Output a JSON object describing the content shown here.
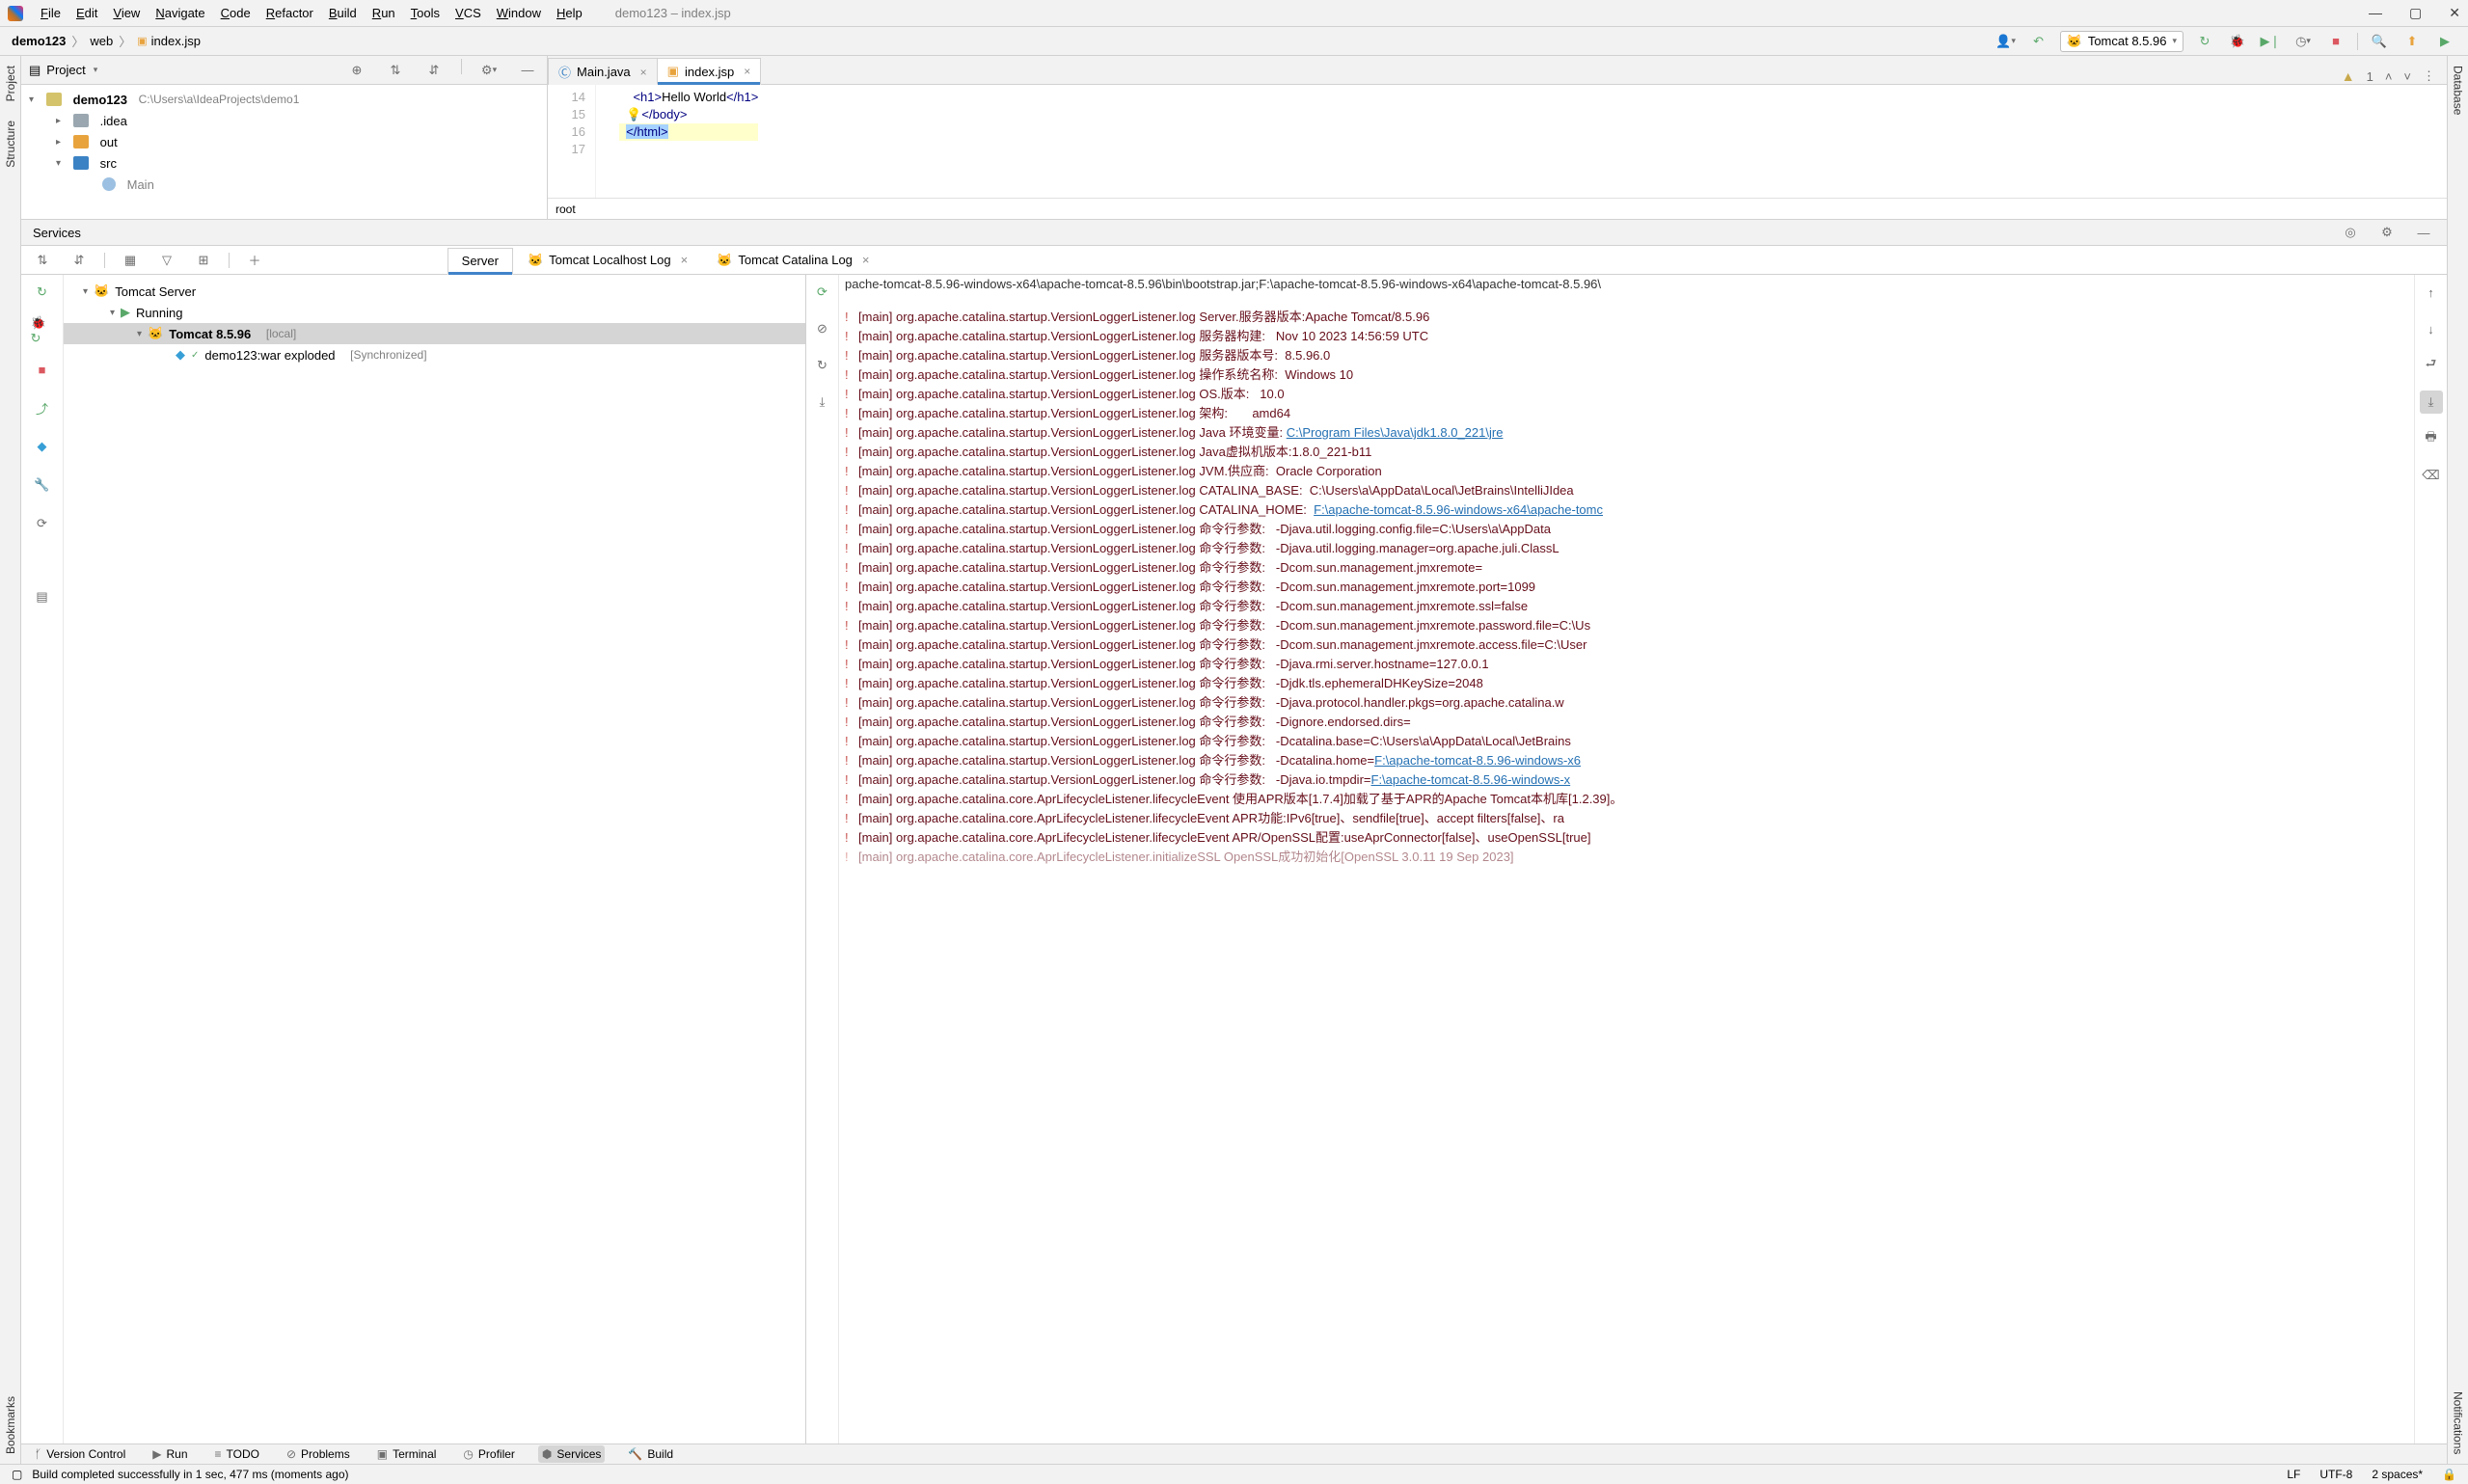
{
  "menu": {
    "items": [
      "File",
      "Edit",
      "View",
      "Navigate",
      "Code",
      "Refactor",
      "Build",
      "Run",
      "Tools",
      "VCS",
      "Window",
      "Help"
    ],
    "title": "demo123 – index.jsp"
  },
  "breadcrumbs": {
    "parts": [
      "demo123",
      "web",
      "index.jsp"
    ]
  },
  "run_config": {
    "label": "Tomcat 8.5.96"
  },
  "left_rail": {
    "top": [
      "Project",
      "Structure"
    ],
    "bottom": "Bookmarks"
  },
  "right_rail": {
    "top": "Database",
    "bottom": "Notifications"
  },
  "project": {
    "title": "Project",
    "root": {
      "name": "demo123",
      "path": "C:\\Users\\a\\IdeaProjects\\demo1"
    },
    "children": [
      {
        "name": ".idea",
        "kind": "dir-gray"
      },
      {
        "name": "out",
        "kind": "dir-orange"
      },
      {
        "name": "src",
        "kind": "dir-blue",
        "expanded": true
      },
      {
        "name": "Main",
        "kind": "file",
        "indent": 3,
        "truncated": true
      }
    ]
  },
  "editor": {
    "tabs": [
      {
        "name": "Main.java",
        "icon": "class"
      },
      {
        "name": "index.jsp",
        "icon": "jsp",
        "active": true
      }
    ],
    "lines": [
      {
        "n": 14,
        "html": "<h1>Hello World</h1>",
        "segments": [
          {
            "t": "<h1>",
            "c": "tag"
          },
          {
            "t": "Hello World",
            "c": "text"
          },
          {
            "t": "</h1>",
            "c": "tag"
          }
        ],
        "indent": "    "
      },
      {
        "n": 15,
        "segments": [
          {
            "t": "💡",
            "c": "bulb"
          },
          {
            "t": "</body>",
            "c": "tag"
          }
        ],
        "indent": "  "
      },
      {
        "n": 16,
        "segments": [
          {
            "t": "</html>",
            "c": "tag sel-tag"
          }
        ],
        "indent": "  ",
        "hi": true
      },
      {
        "n": 17,
        "segments": []
      }
    ],
    "crumb": "root",
    "warnings": "1"
  },
  "services": {
    "title": "Services",
    "tree": {
      "root": "Tomcat Server",
      "running": "Running",
      "item": {
        "name": "Tomcat 8.5.96",
        "suffix": "[local]"
      },
      "artifact": {
        "name": "demo123:war exploded",
        "suffix": "[Synchronized]"
      }
    },
    "tabs": [
      {
        "name": "Server",
        "active": true
      },
      {
        "name": "Tomcat Localhost Log",
        "icon": "tomcat"
      },
      {
        "name": "Tomcat Catalina Log",
        "icon": "tomcat"
      }
    ],
    "top_line": "pache-tomcat-8.5.96-windows-x64\\apache-tomcat-8.5.96\\bin\\bootstrap.jar;F:\\apache-tomcat-8.5.96-windows-x64\\apache-tomcat-8.5.96\\",
    "lines": [
      {
        "p": "[main] org.apache.catalina.startup.VersionLoggerListener.log Server.",
        "cn": "服务器版本:",
        "v": "Apache Tomcat/8.5.96"
      },
      {
        "p": "[main] org.apache.catalina.startup.VersionLoggerListener.log ",
        "cn": "服务器构建:",
        "v": "Nov 10 2023 14:56:59 UTC"
      },
      {
        "p": "[main] org.apache.catalina.startup.VersionLoggerListener.log ",
        "cn": "服务器版本号:",
        "v": "8.5.96.0"
      },
      {
        "p": "[main] org.apache.catalina.startup.VersionLoggerListener.log ",
        "cn": "操作系统名称:",
        "v": "Windows 10"
      },
      {
        "p": "[main] org.apache.catalina.startup.VersionLoggerListener.log OS.",
        "cn": "版本:",
        "v": "10.0"
      },
      {
        "p": "[main] org.apache.catalina.startup.VersionLoggerListener.log ",
        "cn": "架构:",
        "v": " amd64"
      },
      {
        "p": "[main] org.apache.catalina.startup.VersionLoggerListener.log Java ",
        "cn": "环境变量:",
        "v": " ",
        "link": "C:\\Program Files\\Java\\jdk1.8.0_221\\jre"
      },
      {
        "p": "[main] org.apache.catalina.startup.VersionLoggerListener.log Java",
        "cn": "虚拟机版本:",
        "v": "1.8.0_221-b11"
      },
      {
        "p": "[main] org.apache.catalina.startup.VersionLoggerListener.log JVM.",
        "cn": "供应商:",
        "v": " Oracle Corporation"
      },
      {
        "p": "[main] org.apache.catalina.startup.VersionLoggerListener.log CATALINA_BASE:",
        "cn": "",
        "v": "  C:\\Users\\a\\AppData\\Local\\JetBrains\\IntelliJIdea"
      },
      {
        "p": "[main] org.apache.catalina.startup.VersionLoggerListener.log CATALINA_HOME:",
        "cn": "",
        "v": "  ",
        "link": "F:\\apache-tomcat-8.5.96-windows-x64\\apache-tomc"
      },
      {
        "p": "[main] org.apache.catalina.startup.VersionLoggerListener.log ",
        "cn": "命令行参数:",
        "v": "-Djava.util.logging.config.file=C:\\Users\\a\\AppData"
      },
      {
        "p": "[main] org.apache.catalina.startup.VersionLoggerListener.log ",
        "cn": "命令行参数:",
        "v": "-Djava.util.logging.manager=org.apache.juli.ClassL"
      },
      {
        "p": "[main] org.apache.catalina.startup.VersionLoggerListener.log ",
        "cn": "命令行参数:",
        "v": "-Dcom.sun.management.jmxremote="
      },
      {
        "p": "[main] org.apache.catalina.startup.VersionLoggerListener.log ",
        "cn": "命令行参数:",
        "v": "-Dcom.sun.management.jmxremote.port=1099"
      },
      {
        "p": "[main] org.apache.catalina.startup.VersionLoggerListener.log ",
        "cn": "命令行参数:",
        "v": "-Dcom.sun.management.jmxremote.ssl=false"
      },
      {
        "p": "[main] org.apache.catalina.startup.VersionLoggerListener.log ",
        "cn": "命令行参数:",
        "v": "-Dcom.sun.management.jmxremote.password.file=C:\\Us"
      },
      {
        "p": "[main] org.apache.catalina.startup.VersionLoggerListener.log ",
        "cn": "命令行参数:",
        "v": "-Dcom.sun.management.jmxremote.access.file=C:\\User"
      },
      {
        "p": "[main] org.apache.catalina.startup.VersionLoggerListener.log ",
        "cn": "命令行参数:",
        "v": "-Djava.rmi.server.hostname=127.0.0.1"
      },
      {
        "p": "[main] org.apache.catalina.startup.VersionLoggerListener.log ",
        "cn": "命令行参数:",
        "v": "-Djdk.tls.ephemeralDHKeySize=2048"
      },
      {
        "p": "[main] org.apache.catalina.startup.VersionLoggerListener.log ",
        "cn": "命令行参数:",
        "v": "-Djava.protocol.handler.pkgs=org.apache.catalina.w"
      },
      {
        "p": "[main] org.apache.catalina.startup.VersionLoggerListener.log ",
        "cn": "命令行参数:",
        "v": "-Dignore.endorsed.dirs="
      },
      {
        "p": "[main] org.apache.catalina.startup.VersionLoggerListener.log ",
        "cn": "命令行参数:",
        "v": "-Dcatalina.base=C:\\Users\\a\\AppData\\Local\\JetBrains"
      },
      {
        "p": "[main] org.apache.catalina.startup.VersionLoggerListener.log ",
        "cn": "命令行参数:",
        "v": "-Dcatalina.home=",
        "link": "F:\\apache-tomcat-8.5.96-windows-x6"
      },
      {
        "p": "[main] org.apache.catalina.startup.VersionLoggerListener.log ",
        "cn": "命令行参数:",
        "v": "-Djava.io.tmpdir=",
        "link": "F:\\apache-tomcat-8.5.96-windows-x"
      },
      {
        "p": "[main] org.apache.catalina.core.AprLifecycleListener.lifecycleEvent ",
        "cn": "使用APR版本[1.7.4]加载了基于APR的Apache Tomcat本机库[1.2.39]。",
        "v": ""
      },
      {
        "p": "[main] org.apache.catalina.core.AprLifecycleListener.lifecycleEvent APR",
        "cn": "功能:",
        "v": "IPv6[true]、sendfile[true]、accept filters[false]、ra"
      },
      {
        "p": "[main] org.apache.catalina.core.AprLifecycleListener.lifecycleEvent APR/OpenSSL",
        "cn": "配置:",
        "v": "useAprConnector[false]、useOpenSSL[true]"
      },
      {
        "p": "[main] org.apache.catalina.core.AprLifecycleListener.initializeSSL OpenSSL",
        "cn": "成功初始化",
        "v": "[OpenSSL 3.0.11 19 Sep 2023]",
        "fade": true
      }
    ]
  },
  "bottom_tabs": [
    {
      "name": "Version Control",
      "icon": "branch"
    },
    {
      "name": "Run",
      "icon": "play"
    },
    {
      "name": "TODO",
      "icon": "todo"
    },
    {
      "name": "Problems",
      "icon": "problems"
    },
    {
      "name": "Terminal",
      "icon": "terminal"
    },
    {
      "name": "Profiler",
      "icon": "profiler"
    },
    {
      "name": "Services",
      "icon": "services",
      "active": true
    },
    {
      "name": "Build",
      "icon": "build"
    }
  ],
  "status": {
    "msg": "Build completed successfully in 1 sec, 477 ms (moments ago)",
    "right": [
      "LF",
      "UTF-8",
      "2 spaces*",
      "🔒"
    ]
  }
}
